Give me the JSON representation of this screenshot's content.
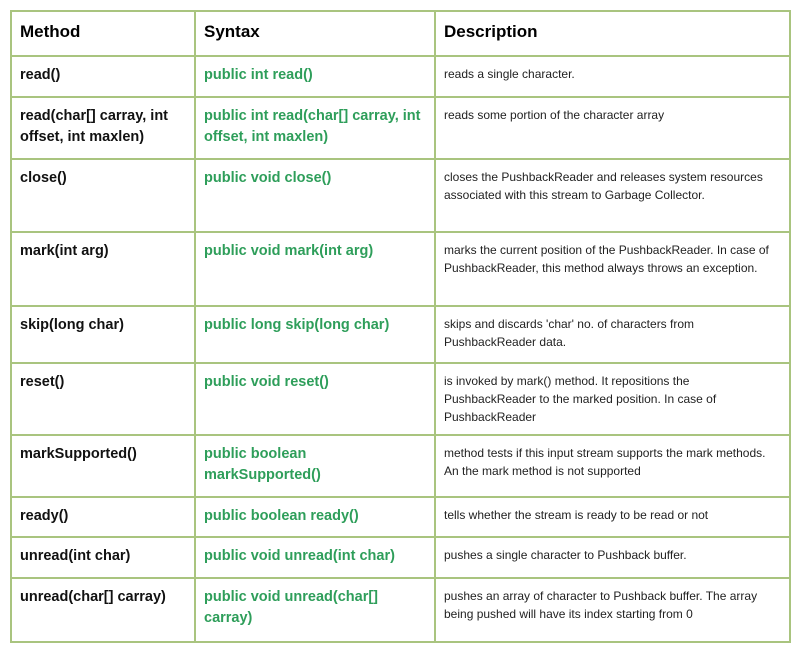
{
  "table": {
    "headers": [
      "Method",
      "Syntax",
      "Description"
    ],
    "rows": [
      {
        "method": "read()",
        "syntax": "public int read()",
        "description": "reads a single character."
      },
      {
        "method": "read(char[] carray, int offset, int maxlen)",
        "syntax": "public int read(char[] carray, int offset, int maxlen)",
        "description": "reads some portion of the character array"
      },
      {
        "method": "close()",
        "syntax": "public void close()",
        "description": "closes the PushbackReader and releases system resources associated with this stream to Garbage Collector."
      },
      {
        "method": "mark(int arg)",
        "syntax": "public void mark(int arg)",
        "description": "marks the current position of the PushbackReader. In case of PushbackReader, this method always throws an exception."
      },
      {
        "method": "skip(long char)",
        "syntax": "public long skip(long char)",
        "description": "skips and discards 'char' no. of characters from PushbackReader data."
      },
      {
        "method": "reset()",
        "syntax": "public void reset()",
        "description": "is invoked by mark() method. It repositions the PushbackReader to the marked position. In case of PushbackReader"
      },
      {
        "method": "markSupported()",
        "syntax": "public boolean markSupported()",
        "description": "method tests if this input stream supports the mark methods. An the mark method is not supported"
      },
      {
        "method": "ready()",
        "syntax": "public boolean ready()",
        "description": "tells whether the stream is ready to be read or not"
      },
      {
        "method": "unread(int char)",
        "syntax": "public void unread(int char)",
        "description": "pushes a single character to Pushback buffer."
      },
      {
        "method": "unread(char[] carray)",
        "syntax": "public void unread(char[] carray)",
        "description": "pushes an array of character to Pushback buffer. The array being pushed will have its index starting from 0"
      }
    ]
  },
  "colors": {
    "border": "#a9c47f",
    "syntax_text": "#2e9e5a",
    "text": "#111111"
  }
}
